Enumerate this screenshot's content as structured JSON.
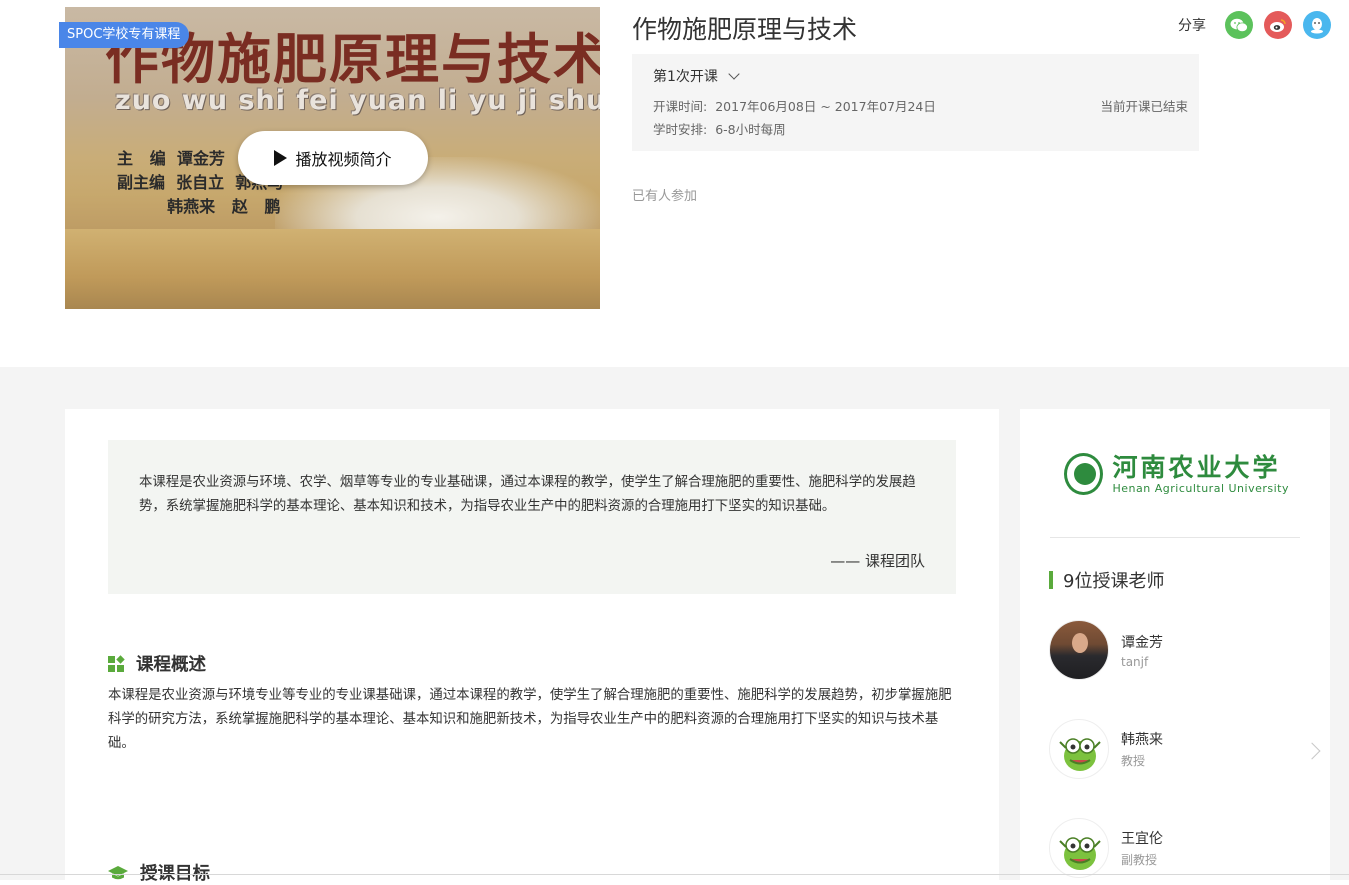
{
  "header": {
    "badge": "SPOC学校专有课程",
    "cover": {
      "book_title": "作物施肥原理与技术",
      "pinyin": "zuo wu shi fei yuan li yu ji shu",
      "authors": "主   编  谭金芳\n副主编  张自立  郭燕马\n         韩燕来   赵   鹏"
    },
    "play_label": "播放视频简介",
    "course_title": "作物施肥原理与技术",
    "share_label": "分享",
    "share_icons": [
      "wechat-icon",
      "weibo-icon",
      "qq-icon"
    ],
    "term": {
      "label": "第1次开课",
      "time_key": "开课时间:",
      "time_value": "2017年06月08日 ~ 2017年07月24日",
      "schedule_key": "学时安排:",
      "schedule_value": "6-8小时每周",
      "status": "当前开课已结束"
    },
    "joined": "已有人参加"
  },
  "main": {
    "quote": "本课程是农业资源与环境、农学、烟草等专业的专业基础课，通过本课程的教学，使学生了解合理施肥的重要性、施肥科学的发展趋势，系统掌握施肥科学的基本理论、基本知识和技术，为指导农业生产中的肥料资源的合理施用打下坚实的知识基础。",
    "quote_sign": "—— 课程团队",
    "overview_title": "课程概述",
    "overview_text": " 本课程是农业资源与环境专业等专业的专业课基础课，通过本课程的教学，使学生了解合理施肥的重要性、施肥科学的发展趋势，初步掌握施肥科学的研究方法，系统掌握施肥科学的基本理论、基本知识和施肥新技术，为指导农业生产中的肥料资源的合理施用打下坚实的知识与技术基础。",
    "goals_title": "授课目标"
  },
  "sidebar": {
    "school_cn": "河南农业大学",
    "school_en": "Henan Agricultural University",
    "teachers_title": "9位授课老师",
    "teachers": [
      {
        "name": "谭金芳",
        "role": "tanjf"
      },
      {
        "name": "韩燕来",
        "role": "教授"
      },
      {
        "name": "王宜伦",
        "role": "副教授"
      }
    ]
  },
  "colors": {
    "accent_green": "#5aaa3c",
    "badge_blue": "#4a86e8",
    "wechat": "#5cc25c",
    "weibo": "#e45a5a",
    "qq": "#4ab7ee"
  }
}
